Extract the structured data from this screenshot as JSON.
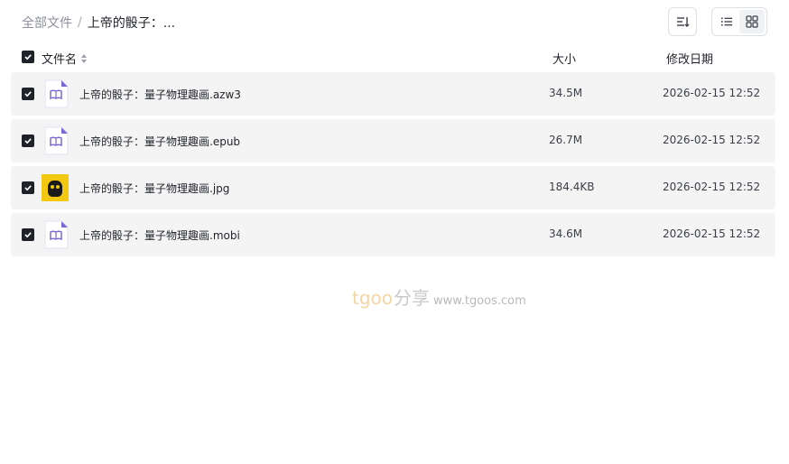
{
  "breadcrumb": {
    "root": "全部文件",
    "separator": "/",
    "current": "上帝的骰子：..."
  },
  "toolbar": {
    "sort_icon": "sort-icon",
    "list_view_icon": "list-view-icon",
    "grid_view_icon": "grid-view-icon"
  },
  "table_header": {
    "name": "文件名",
    "size": "大小",
    "date": "修改日期"
  },
  "files": [
    {
      "name": "上帝的骰子：量子物理趣画.azw3",
      "size": "34.5M",
      "date": "2026-02-15 12:52",
      "icon": "ebook-icon",
      "checked": true
    },
    {
      "name": "上帝的骰子：量子物理趣画.epub",
      "size": "26.7M",
      "date": "2026-02-15 12:52",
      "icon": "ebook-icon",
      "checked": true
    },
    {
      "name": "上帝的骰子：量子物理趣画.jpg",
      "size": "184.4KB",
      "date": "2026-02-15 12:52",
      "icon": "image-thumbnail",
      "checked": true
    },
    {
      "name": "上帝的骰子：量子物理趣画.mobi",
      "size": "34.6M",
      "date": "2026-02-15 12:52",
      "icon": "ebook-icon",
      "checked": true
    }
  ],
  "watermark": {
    "brand": "tgoo",
    "share": "分享",
    "url": "www.tgoos.com"
  },
  "colors": {
    "row_background": "#f4f4f5",
    "checkbox": "#1f2329",
    "ebook_icon_accent": "#7b68d6",
    "watermark_brand": "#f3d6a4"
  }
}
